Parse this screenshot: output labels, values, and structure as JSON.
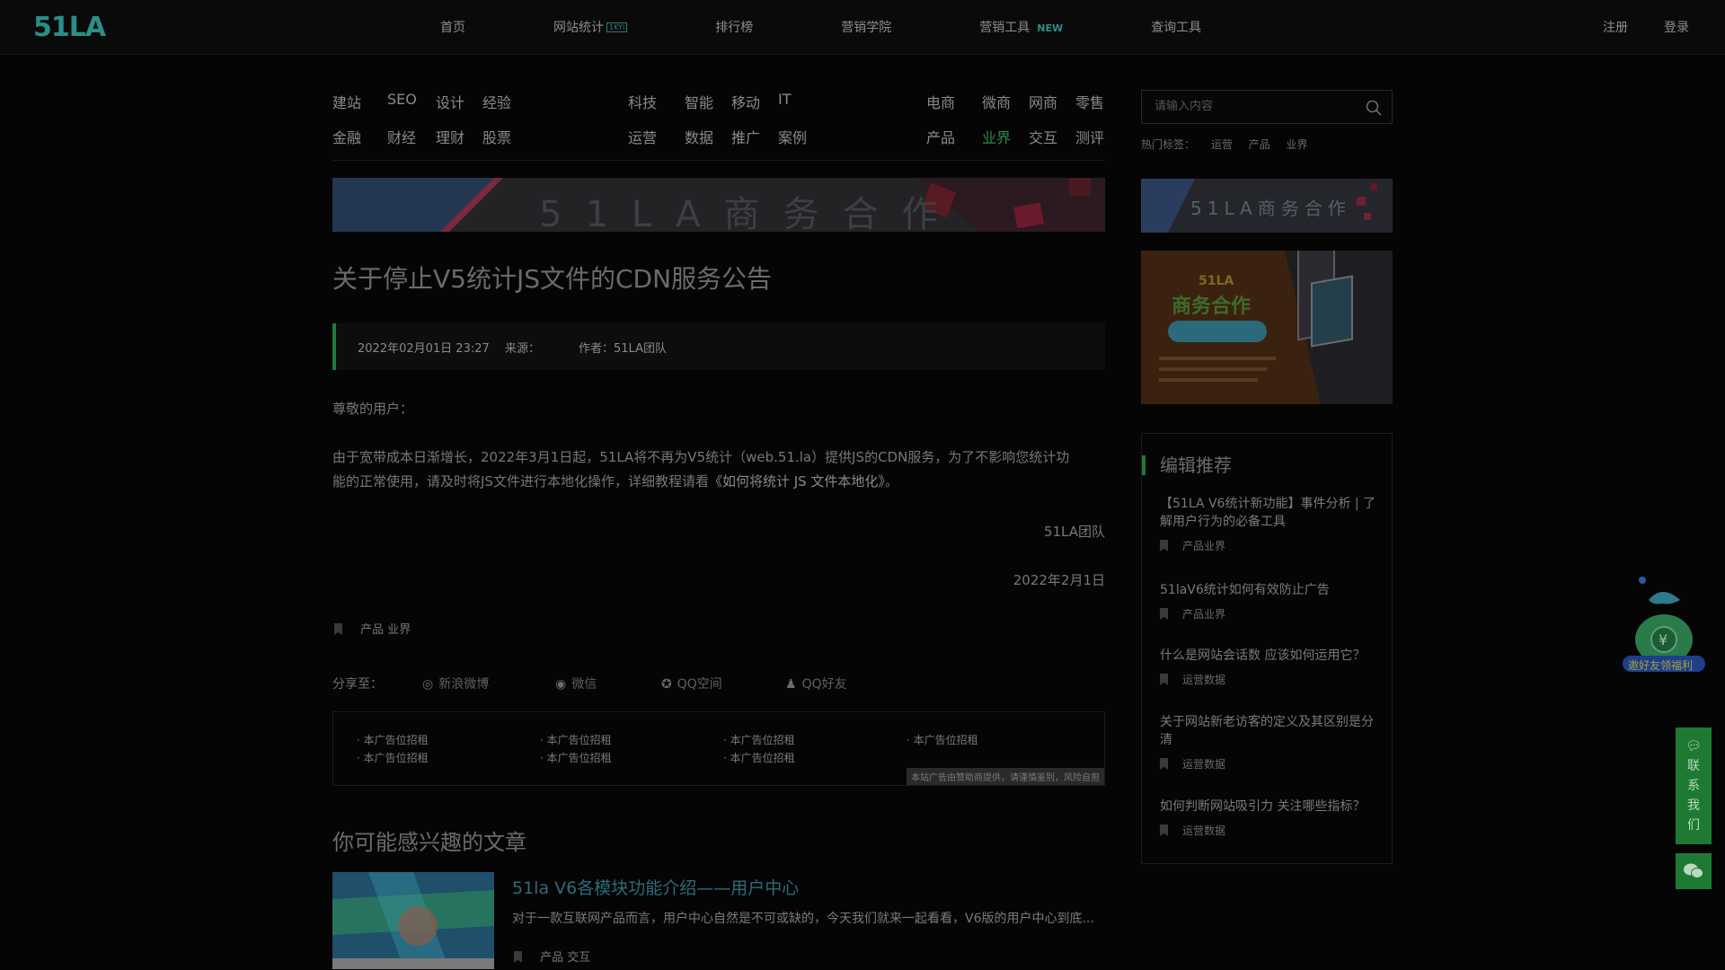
{
  "header": {
    "logo": "51LA",
    "nav": [
      {
        "label": "首页"
      },
      {
        "label": "网站统计",
        "badge": "1KYI"
      },
      {
        "label": "排行榜"
      },
      {
        "label": "营销学院"
      },
      {
        "label": "营销工具",
        "badge": "NEW"
      },
      {
        "label": "查询工具"
      }
    ],
    "register": "注册",
    "login": "登录"
  },
  "categories": {
    "group1": [
      "建站",
      "SEO",
      "设计",
      "经验",
      "金融",
      "财经",
      "理财",
      "股票"
    ],
    "group2": [
      "科技",
      "智能",
      "移动",
      "IT",
      "运营",
      "数据",
      "推广",
      "案例"
    ],
    "group3": [
      "电商",
      "微商",
      "网商",
      "零售",
      "产品",
      "业界",
      "交互",
      "测评"
    ],
    "active": "业界"
  },
  "search": {
    "placeholder": "请输入内容",
    "hot_label": "热门标签：",
    "hot_tags": [
      "运营",
      "产品",
      "业界"
    ]
  },
  "banners": {
    "main_text": "51LA商务合作",
    "side_text": "51LA商务合作",
    "promo_brand": "51LA",
    "promo_title": "商务合作"
  },
  "article": {
    "title": "关于停止V5统计JS文件的CDN服务公告",
    "date": "2022年02月01日 23:27",
    "source_label": "来源：",
    "author": "作者：51LA团队",
    "greeting": "尊敬的用户：",
    "body_line1": "由于宽带成本日渐增长，2022年3月1日起，51LA将不再为V5统计（web.51.la）提供JS的CDN服务，为了不影响您统计功",
    "body_line2_start": "能的正常使用，请及时将JS文件进行本地化操作，详细教程请看",
    "body_link": "《如何将统计 JS 文件本地化》",
    "body_line2_end": "。",
    "signature": "51LA团队",
    "sign_date": "2022年2月1日",
    "tags": [
      "产品",
      "业界"
    ]
  },
  "share": {
    "label": "分享至：",
    "items": [
      "新浪微博",
      "微信",
      "QQ空间",
      "QQ好友"
    ]
  },
  "ads": {
    "items": [
      "本广告位招租",
      "本广告位招租",
      "本广告位招租",
      "本广告位招租",
      "本广告位招租",
      "本广告位招租",
      "本广告位招租"
    ],
    "note": "本站广告由赞助商提供，请谨慎鉴别，风险自担"
  },
  "related": {
    "section_title": "你可能感兴趣的文章",
    "title": "51la V6各模块功能介绍——用户中心",
    "desc": "对于一款互联网产品而言，用户中心自然是不可或缺的，今天我们就来一起看看，V6版的用户中心到底...",
    "tags": [
      "产品",
      "交互"
    ]
  },
  "editor_picks": {
    "heading": "编辑推荐",
    "items": [
      {
        "title": "【51LA V6统计新功能】事件分析 | 了解用户行为的必备工具",
        "tags": [
          "产品",
          "业界"
        ]
      },
      {
        "title": "51laV6统计如何有效防止广告",
        "tags": [
          "产品",
          "业界"
        ]
      },
      {
        "title": "什么是网站会话数 应该如何运用它？",
        "tags": [
          "运营",
          "数据"
        ]
      },
      {
        "title": "关于网站新老访客的定义及其区别是分清",
        "tags": [
          "运营",
          "数据"
        ]
      },
      {
        "title": "如何判断网站吸引力 关注哪些指标？",
        "tags": [
          "运营",
          "数据"
        ]
      }
    ]
  },
  "floating": {
    "mascot_label": "邀好友领福利",
    "contact": "联系我们"
  },
  "colors": {
    "accent_green": "#1f7a38",
    "logo_teal": "#2c8e86",
    "background": "#050505"
  }
}
